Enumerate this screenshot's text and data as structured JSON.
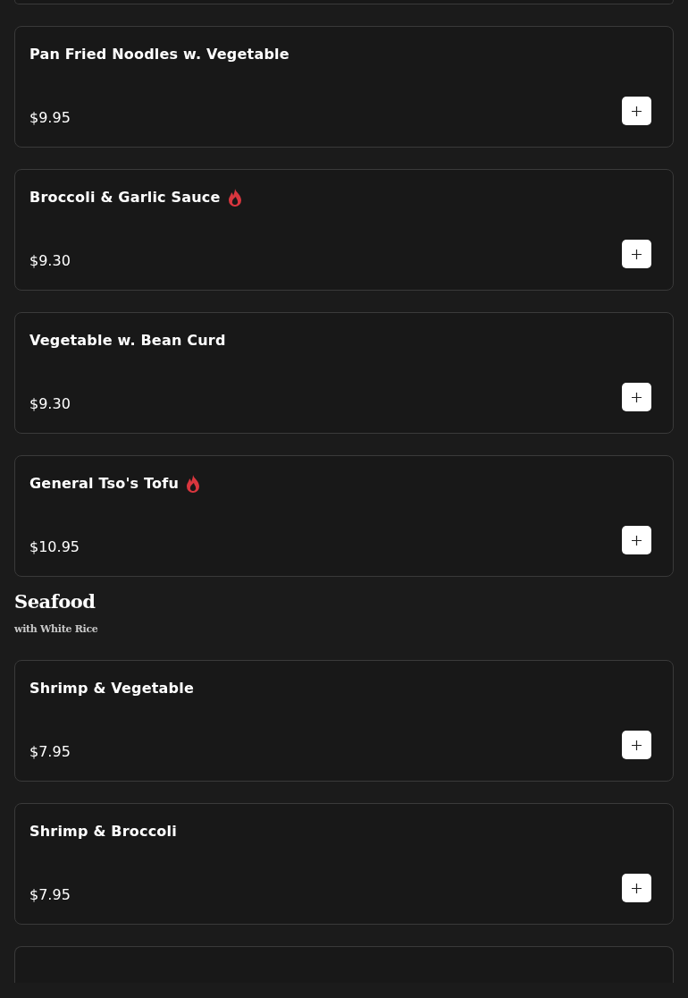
{
  "sections": [
    {
      "items": [
        {
          "name": "Pan Fried Noodles w. Vegetable",
          "price": "$9.95",
          "spicy": false
        },
        {
          "name": "Broccoli & Garlic Sauce",
          "price": "$9.30",
          "spicy": true
        },
        {
          "name": "Vegetable w. Bean Curd",
          "price": "$9.30",
          "spicy": false
        },
        {
          "name": "General Tso's Tofu",
          "price": "$10.95",
          "spicy": true
        }
      ]
    },
    {
      "title": "Seafood",
      "subtitle": "with White Rice",
      "items": [
        {
          "name": "Shrimp & Vegetable",
          "price": "$7.95",
          "spicy": false
        },
        {
          "name": "Shrimp & Broccoli",
          "price": "$7.95",
          "spicy": false
        }
      ]
    }
  ]
}
